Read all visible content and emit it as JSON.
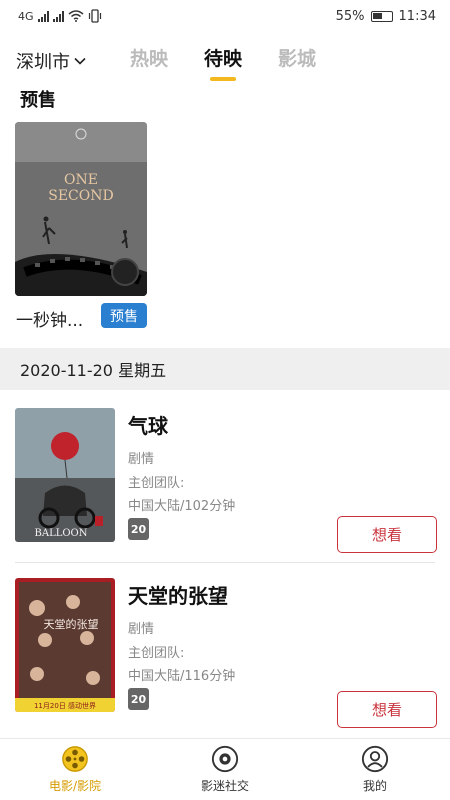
{
  "status_bar": {
    "signal_left": "4G",
    "battery_percent": "55%",
    "time": "11:34"
  },
  "top_nav": {
    "city": "深圳市",
    "tabs": [
      {
        "label": "热映",
        "active": false
      },
      {
        "label": "待映",
        "active": true
      },
      {
        "label": "影城",
        "active": false
      }
    ]
  },
  "presale": {
    "title": "预售",
    "movie": {
      "name": "一秒钟...",
      "badge": "预售",
      "poster_text": "ONE SECOND"
    }
  },
  "date_header": "2020-11-20 星期五",
  "movies": [
    {
      "title": "气球",
      "genre": "剧情",
      "team": "主创团队:",
      "info": "中国大陆/102分钟",
      "age": "20",
      "action": "想看",
      "poster_text": "BALLOON"
    },
    {
      "title": "天堂的张望",
      "genre": "剧情",
      "team": "主创团队:",
      "info": "中国大陆/116分钟",
      "age": "20",
      "action": "想看",
      "poster_text": "天堂的张望",
      "poster_footer": "11月20日 感动世界"
    }
  ],
  "bottom_nav": [
    {
      "label": "电影/影院",
      "icon": "film-reel-icon",
      "active": true
    },
    {
      "label": "影迷社交",
      "icon": "camera-lens-icon",
      "active": false
    },
    {
      "label": "我的",
      "icon": "user-icon",
      "active": false
    }
  ],
  "colors": {
    "accent": "#f3b81d",
    "active_nav": "#d69b00",
    "want_button": "#c8333c",
    "presale_badge": "#2b7fd1"
  }
}
